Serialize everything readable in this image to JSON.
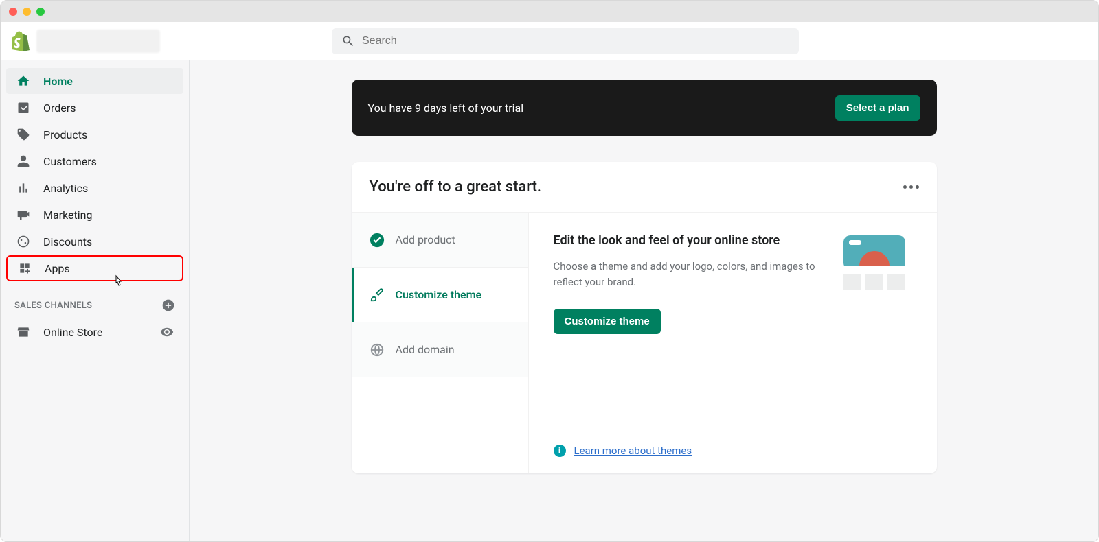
{
  "search": {
    "placeholder": "Search"
  },
  "sidebar": {
    "items": [
      {
        "label": "Home"
      },
      {
        "label": "Orders"
      },
      {
        "label": "Products"
      },
      {
        "label": "Customers"
      },
      {
        "label": "Analytics"
      },
      {
        "label": "Marketing"
      },
      {
        "label": "Discounts"
      },
      {
        "label": "Apps"
      }
    ],
    "section_label": "SALES CHANNELS",
    "channels": [
      {
        "label": "Online Store"
      }
    ]
  },
  "trial": {
    "message": "You have 9 days left of your trial",
    "button": "Select a plan"
  },
  "card": {
    "title": "You're off to a great start.",
    "steps": [
      {
        "label": "Add product"
      },
      {
        "label": "Customize theme"
      },
      {
        "label": "Add domain"
      }
    ],
    "content": {
      "heading": "Edit the look and feel of your online store",
      "body": "Choose a theme and add your logo, colors, and images to reflect your brand.",
      "button": "Customize theme",
      "learn_link": "Learn more about themes"
    }
  }
}
